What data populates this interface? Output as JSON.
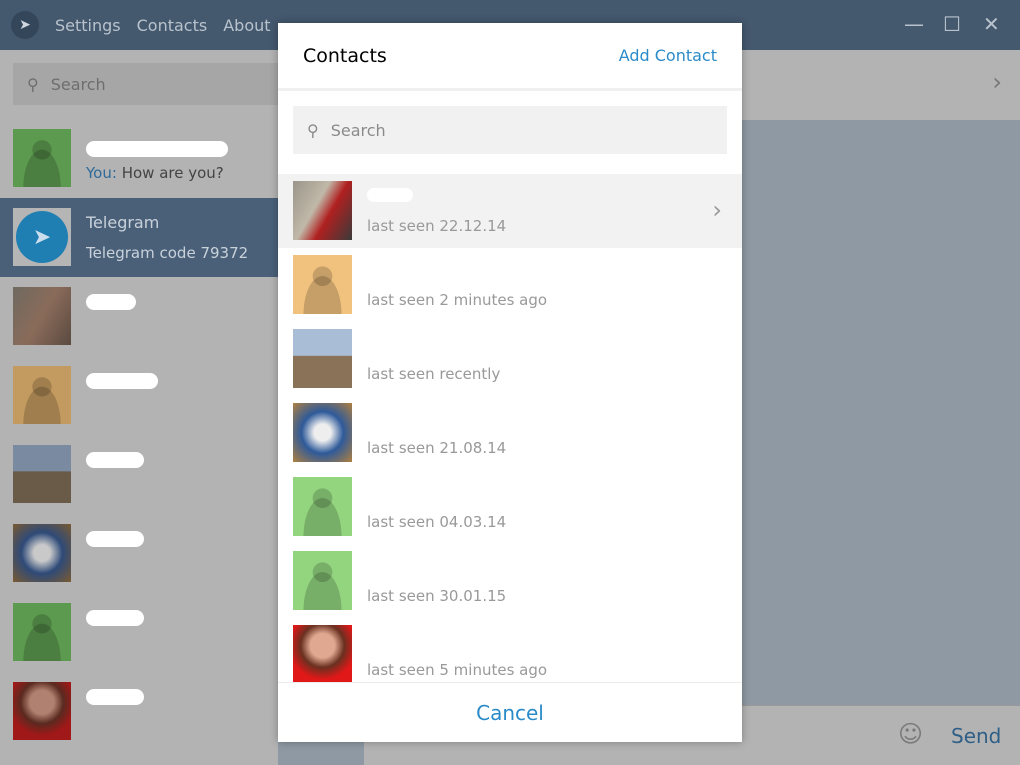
{
  "titlebar": {
    "menu": [
      "Settings",
      "Contacts",
      "About"
    ]
  },
  "sidebar": {
    "search_placeholder": "Search",
    "chats": [
      {
        "preview_prefix": "You:",
        "preview": "How are you?",
        "avatar": "#5c9a4f"
      },
      {
        "name": "Telegram",
        "preview": "Telegram code 79372",
        "avatar": "telegram-logo",
        "selected": true
      },
      {
        "avatar": "photo"
      },
      {
        "avatar": "#c39a5f"
      },
      {
        "avatar": "photo"
      },
      {
        "avatar": "photo"
      },
      {
        "avatar": "#5c9a4f"
      },
      {
        "avatar": "photo"
      }
    ]
  },
  "composer": {
    "send_label": "Send"
  },
  "modal": {
    "title": "Contacts",
    "add_contact": "Add Contact",
    "search_placeholder": "Search",
    "cancel": "Cancel",
    "contacts": [
      {
        "status": "last seen 22.12.14",
        "avatar": "photo-1",
        "selected": true
      },
      {
        "status": "last seen 2 minutes ago",
        "avatar": "#f0c27e"
      },
      {
        "status": "last seen recently",
        "avatar": "photo-2"
      },
      {
        "status": "last seen 21.08.14",
        "avatar": "photo-3"
      },
      {
        "status": "last seen 04.03.14",
        "avatar": "#93d57f"
      },
      {
        "status": "last seen 30.01.15",
        "avatar": "#93d57f"
      },
      {
        "status": "last seen 5 minutes ago",
        "avatar": "photo-4"
      }
    ]
  },
  "colors": {
    "accent": "#2a8bc8",
    "titlebar": "#44586e",
    "selected": "#4a6079"
  }
}
